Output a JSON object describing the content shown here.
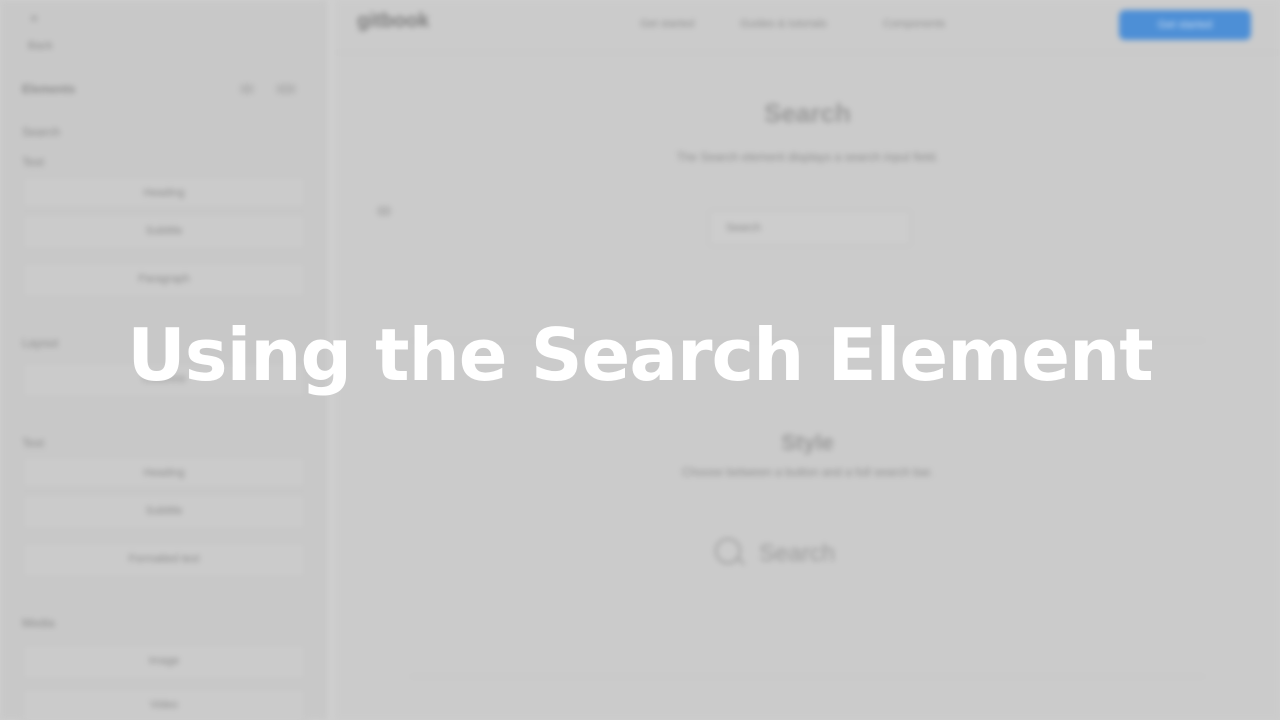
{
  "overlay": {
    "title": "Using the Search Element"
  },
  "app": {
    "logo": "gitbook",
    "topnav": [
      "Get started",
      "Guides & tutorials",
      "Components"
    ],
    "cta_label": "Get started"
  },
  "sidebar": {
    "close_label": "×",
    "back_label": "Back",
    "header_label": "Elements",
    "section_title": "Search",
    "section_label": "Text",
    "groups": [
      {
        "label": "",
        "rows": [
          "Heading",
          "Subtitle",
          "Paragraph"
        ]
      },
      {
        "label": "Layout",
        "rows": [
          "Columns"
        ]
      },
      {
        "label": "Text",
        "rows": [
          "Heading",
          "Subtitle",
          "Formatted text"
        ]
      },
      {
        "label": "Media",
        "rows": [
          "Image",
          "Video"
        ]
      }
    ]
  },
  "main": {
    "page_title": "Search",
    "page_subtitle": "The Search element displays a search input field.",
    "search_placeholder": "Search",
    "section_title": "Style",
    "section_subtitle": "Choose between a button and a full search bar.",
    "demo_search_label": "Search"
  },
  "colors": {
    "background": "#cfcfcf",
    "accent": "#4d8fd6",
    "overlay_text": "#ffffff"
  }
}
